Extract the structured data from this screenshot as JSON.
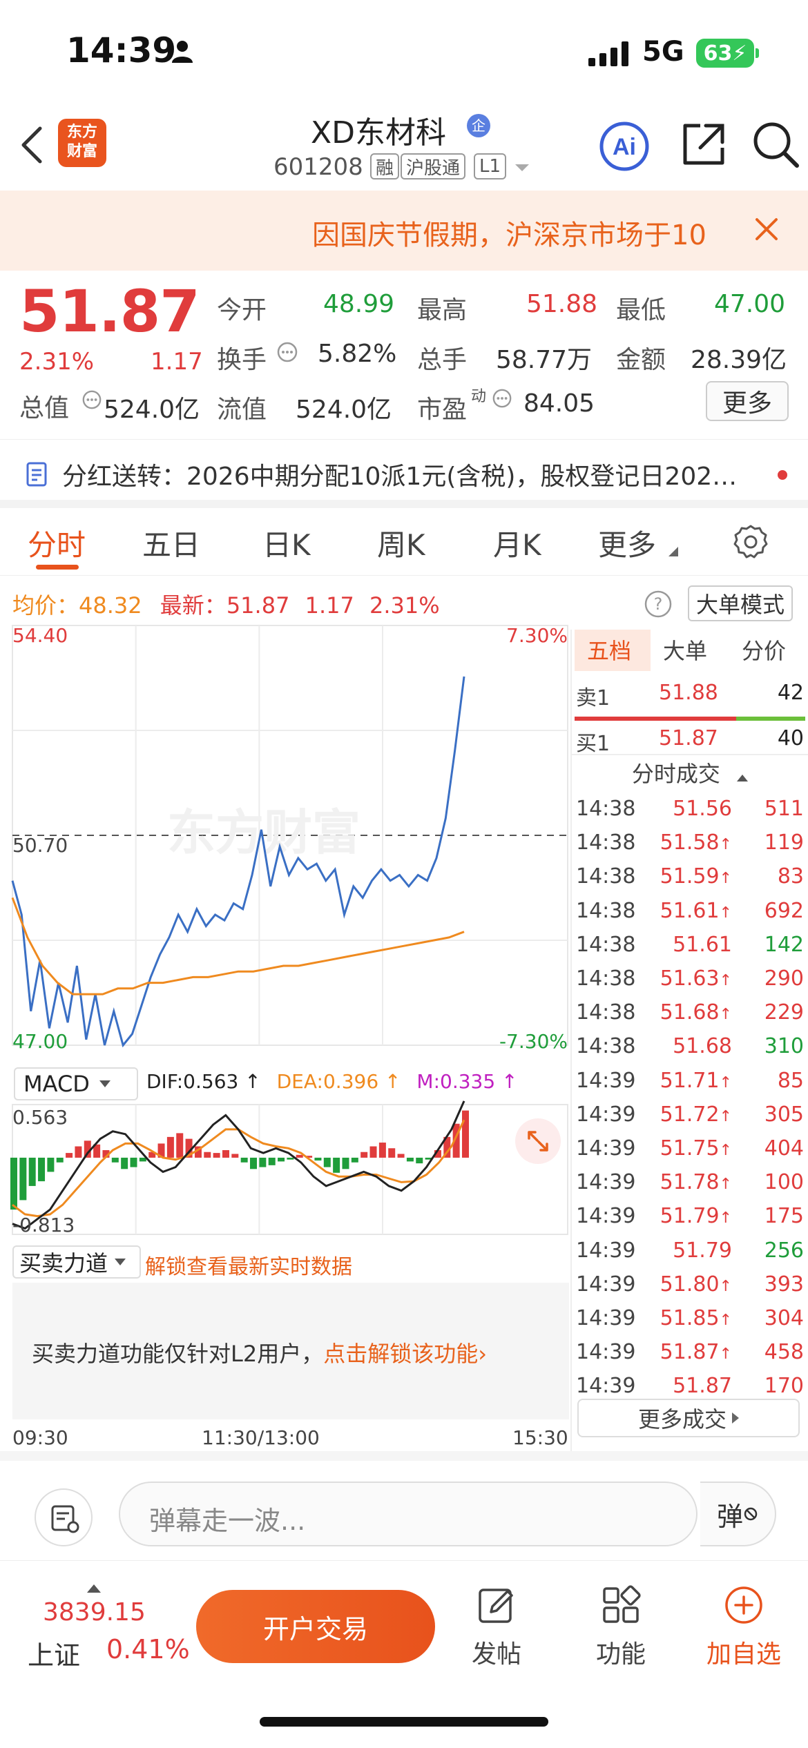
{
  "status_bar": {
    "time": "14:39",
    "network": "5G",
    "battery": "63"
  },
  "nav": {
    "brand_logo_line1": "东方",
    "brand_logo_line2": "财富",
    "stock_name": "XD东材科",
    "enterprise_badge": "企",
    "stock_code": "601208",
    "tags": [
      "融",
      "沪股通",
      "L1"
    ],
    "ai_label": "Ai"
  },
  "notice": {
    "text": "因国庆节假期，沪深京市场于10"
  },
  "quote": {
    "price": "51.87",
    "change_pct": "2.31%",
    "change": "1.17",
    "fields": [
      {
        "label": "今开",
        "value": "48.99",
        "color": "green"
      },
      {
        "label": "最高",
        "value": "51.88",
        "color": "red"
      },
      {
        "label": "最低",
        "value": "47.00",
        "color": "green"
      },
      {
        "label": "换手",
        "value": "5.82%",
        "color": "dark"
      },
      {
        "label": "总手",
        "value": "58.77万",
        "color": "dark"
      },
      {
        "label": "金额",
        "value": "28.39亿",
        "color": "dark"
      },
      {
        "label": "流值",
        "value": "524.0亿",
        "color": "dark"
      },
      {
        "label": "市盈",
        "value": "84.05",
        "color": "dark"
      }
    ],
    "pe_superscript": "动",
    "market_cap_label": "总值",
    "market_cap_value": "524.0亿",
    "more_label": "更多"
  },
  "dividend": {
    "text": "分红送转：2026中期分配10派1元(含税)，股权登记日202…"
  },
  "tabs": [
    "分时",
    "五日",
    "日K",
    "周K",
    "月K",
    "更多"
  ],
  "chart_header": {
    "avg_label": "均价：",
    "avg_value": "48.32",
    "latest_label": "最新：",
    "latest_value": "51.87",
    "latest_change": "1.17",
    "latest_pct": "2.31%",
    "mode_button": "大单模式"
  },
  "chart_data": {
    "type": "line",
    "title": "",
    "y_labels": {
      "top": "54.40",
      "mid": "50.70",
      "bottom": "47.00",
      "pct_top": "7.30%",
      "pct_bottom": "-7.30%"
    },
    "ylim": [
      47.0,
      54.4
    ],
    "reference_price": 50.7,
    "watermark": "东方财富",
    "time_labels": [
      "09:30",
      "11:30/13:00",
      "15:30"
    ],
    "series": [
      {
        "name": "",
        "color": "#3a6fc4",
        "values": [
          49.9,
          49.3,
          47.6,
          48.5,
          47.3,
          48.1,
          47.4,
          48.4,
          47.1,
          47.9,
          47.0,
          47.6,
          47.0,
          47.2,
          47.7,
          48.2,
          48.6,
          48.9,
          49.3,
          49.0,
          49.4,
          49.1,
          49.3,
          49.2,
          49.5,
          49.4,
          50.0,
          50.8,
          49.8,
          50.5,
          50.0,
          50.3,
          50.1,
          50.2,
          49.9,
          50.1,
          49.3,
          49.8,
          49.6,
          49.9,
          50.1,
          49.9,
          50.0,
          49.8,
          50.0,
          49.9,
          50.3,
          51.0,
          52.2,
          53.5
        ],
        "caption": "price"
      },
      {
        "name": "",
        "color": "#ef8a1f",
        "values": [
          49.6,
          48.9,
          48.4,
          48.1,
          47.9,
          47.9,
          47.9,
          48.0,
          48.0,
          48.1,
          48.1,
          48.15,
          48.2,
          48.2,
          48.25,
          48.3,
          48.3,
          48.35,
          48.4,
          48.4,
          48.45,
          48.5,
          48.55,
          48.6,
          48.65,
          48.7,
          48.75,
          48.8,
          48.85,
          48.9,
          49.0
        ],
        "caption": "avg"
      }
    ],
    "macd": {
      "dif": "DIF:0.563",
      "dea": "DEA:0.396",
      "m": "M:0.335",
      "dif_arrow": "↑",
      "dea_arrow": "↑",
      "m_arrow": "↑",
      "ylim_labels": [
        "0.563",
        "-0.813"
      ],
      "histogram": [
        -0.55,
        -0.45,
        -0.3,
        -0.25,
        -0.15,
        -0.05,
        0.05,
        0.12,
        0.18,
        0.14,
        0.08,
        -0.05,
        -0.12,
        -0.1,
        -0.04,
        0.06,
        0.15,
        0.22,
        0.26,
        0.2,
        0.12,
        0.06,
        0.05,
        0.08,
        0.04,
        -0.05,
        -0.12,
        -0.1,
        -0.08,
        -0.04,
        -0.02,
        0.03,
        0.02,
        -0.03,
        -0.1,
        -0.16,
        -0.12,
        -0.05,
        0.06,
        0.12,
        0.16,
        0.1,
        0.04,
        -0.04,
        -0.06,
        -0.02,
        0.08,
        0.22,
        0.36,
        0.5
      ],
      "dif_values": [
        -0.7,
        -0.75,
        -0.65,
        -0.55,
        -0.35,
        -0.15,
        0.05,
        0.2,
        0.28,
        0.25,
        0.1,
        -0.05,
        -0.15,
        -0.1,
        0.05,
        0.2,
        0.35,
        0.45,
        0.3,
        0.1,
        0.05,
        0.1,
        0.05,
        -0.05,
        -0.2,
        -0.3,
        -0.25,
        -0.2,
        -0.15,
        -0.2,
        -0.3,
        -0.35,
        -0.25,
        -0.1,
        0.1,
        0.3,
        0.6
      ],
      "dea_values": [
        -0.5,
        -0.6,
        -0.62,
        -0.6,
        -0.5,
        -0.35,
        -0.2,
        -0.05,
        0.08,
        0.15,
        0.15,
        0.08,
        0.0,
        -0.02,
        0.02,
        0.1,
        0.2,
        0.3,
        0.3,
        0.22,
        0.15,
        0.12,
        0.1,
        0.05,
        -0.05,
        -0.15,
        -0.2,
        -0.2,
        -0.18,
        -0.18,
        -0.22,
        -0.26,
        -0.25,
        -0.18,
        -0.05,
        0.12,
        0.4
      ]
    }
  },
  "order_book": {
    "tabs": [
      "五档",
      "大单",
      "分价"
    ],
    "sell_label": "卖1",
    "sell_price": "51.88",
    "sell_volume": "42",
    "buy_label": "买1",
    "buy_price": "51.87",
    "buy_volume": "40"
  },
  "trades": {
    "title": "分时成交",
    "rows": [
      {
        "time": "14:38",
        "price": "51.56",
        "arrow": "",
        "vol": "511",
        "color": "red"
      },
      {
        "time": "14:38",
        "price": "51.58",
        "arrow": "↑",
        "vol": "119",
        "color": "red"
      },
      {
        "time": "14:38",
        "price": "51.59",
        "arrow": "↑",
        "vol": "83",
        "color": "red"
      },
      {
        "time": "14:38",
        "price": "51.61",
        "arrow": "↑",
        "vol": "692",
        "color": "red"
      },
      {
        "time": "14:38",
        "price": "51.61",
        "arrow": "",
        "vol": "142",
        "color": "green"
      },
      {
        "time": "14:38",
        "price": "51.63",
        "arrow": "↑",
        "vol": "290",
        "color": "red"
      },
      {
        "time": "14:38",
        "price": "51.68",
        "arrow": "↑",
        "vol": "229",
        "color": "red"
      },
      {
        "time": "14:38",
        "price": "51.68",
        "arrow": "",
        "vol": "310",
        "color": "green"
      },
      {
        "time": "14:39",
        "price": "51.71",
        "arrow": "↑",
        "vol": "85",
        "color": "red"
      },
      {
        "time": "14:39",
        "price": "51.72",
        "arrow": "↑",
        "vol": "305",
        "color": "red"
      },
      {
        "time": "14:39",
        "price": "51.75",
        "arrow": "↑",
        "vol": "404",
        "color": "red"
      },
      {
        "time": "14:39",
        "price": "51.78",
        "arrow": "↑",
        "vol": "100",
        "color": "red"
      },
      {
        "time": "14:39",
        "price": "51.79",
        "arrow": "↑",
        "vol": "175",
        "color": "red"
      },
      {
        "time": "14:39",
        "price": "51.79",
        "arrow": "",
        "vol": "256",
        "color": "green"
      },
      {
        "time": "14:39",
        "price": "51.80",
        "arrow": "↑",
        "vol": "393",
        "color": "red"
      },
      {
        "time": "14:39",
        "price": "51.85",
        "arrow": "↑",
        "vol": "304",
        "color": "red"
      },
      {
        "time": "14:39",
        "price": "51.87",
        "arrow": "↑",
        "vol": "458",
        "color": "red"
      },
      {
        "time": "14:39",
        "price": "51.87",
        "arrow": "",
        "vol": "170",
        "color": "red"
      }
    ],
    "more_label": "更多成交"
  },
  "macd_select": "MACD",
  "force": {
    "select_label": "买卖力道",
    "unlock_hint": "解锁查看最新实时数据",
    "message": "买卖力道功能仅针对L2用户，",
    "link": "点击解锁该功能"
  },
  "comment": {
    "placeholder": "弹幕走一波...",
    "danmaku_label": "弹"
  },
  "bottom_bar": {
    "index_value": "3839.15",
    "index_name": "上证",
    "index_pct": "0.41%",
    "trade_button": "开户交易",
    "post_label": "发帖",
    "func_label": "功能",
    "watch_label": "加自选"
  },
  "colors": {
    "up": "#e03c3c",
    "down": "#1f9d3a",
    "accent": "#e8521c",
    "avg": "#ef8a1f",
    "price_line": "#3a6fc4"
  }
}
